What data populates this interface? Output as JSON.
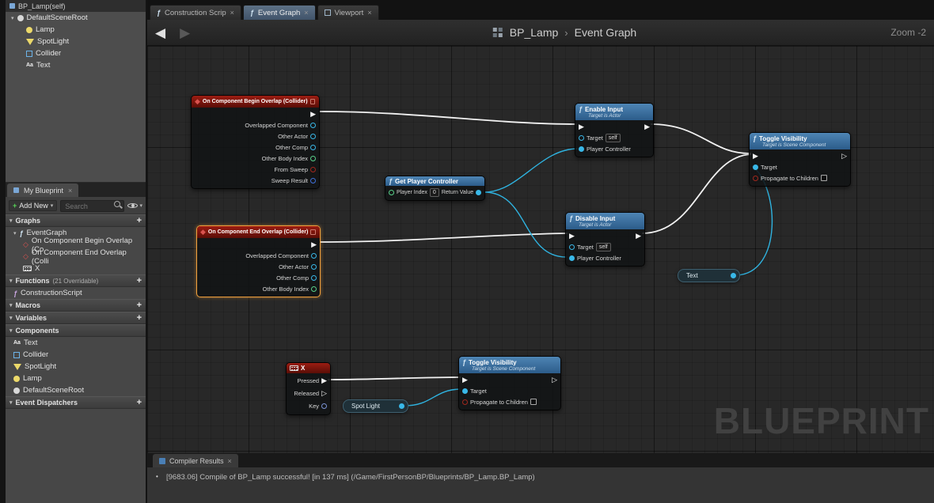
{
  "icons": {
    "caret_down": "▾",
    "plus": "+",
    "close": "×",
    "back_arrow": "◀",
    "forward_arrow": "▶",
    "exec_filled": "▶",
    "exec_hollow": "▷",
    "event_diamond": "◆",
    "event_diamond_hollow": "◇",
    "fn_glyph": "ƒ",
    "bullet": "•",
    "text_glyph": "Aa"
  },
  "components_panel": {
    "header": "BP_Lamp(self)",
    "root": "DefaultSceneRoot",
    "children": [
      "Lamp",
      "SpotLight",
      "Collider",
      "Text"
    ]
  },
  "my_blueprint": {
    "tab": "My Blueprint",
    "add_new": "Add New",
    "search_placeholder": "Search",
    "sections": {
      "graphs": "Graphs",
      "functions": "Functions",
      "functions_badge": "(21 Overridable)",
      "macros": "Macros",
      "variables": "Variables",
      "components": "Components",
      "dispatchers": "Event Dispatchers"
    },
    "graph_items": [
      "EventGraph",
      "On Component Begin Overlap (Co",
      "On Component End Overlap (Colli",
      "X"
    ],
    "function_items": [
      "ConstructionScript"
    ],
    "component_items": [
      "Text",
      "Collider",
      "SpotLight",
      "Lamp",
      "DefaultSceneRoot"
    ]
  },
  "doc_tabs": [
    "Construction Scrip",
    "Event Graph",
    "Viewport"
  ],
  "graph_toolbar": {
    "breadcrumb_root": "BP_Lamp",
    "breadcrumb_sep": "›",
    "breadcrumb_page": "Event Graph",
    "zoom": "Zoom -2"
  },
  "graph": {
    "watermark": "BLUEPRINT",
    "nodes": {
      "begin_overlap": {
        "title": "On Component Begin Overlap (Collider)",
        "pins": [
          "Overlapped Component",
          "Other Actor",
          "Other Comp",
          "Other Body Index",
          "From Sweep",
          "Sweep Result"
        ]
      },
      "end_overlap": {
        "title": "On Component End Overlap (Collider)",
        "pins": [
          "Overlapped Component",
          "Other Actor",
          "Other Comp",
          "Other Body Index"
        ]
      },
      "get_player_controller": {
        "title": "Get Player Controller",
        "input_label": "Player Index",
        "input_value": "0",
        "output_label": "Return Value"
      },
      "enable_input": {
        "title": "Enable Input",
        "subtitle": "Target is Actor",
        "target_label": "Target",
        "target_value": "self",
        "controller_label": "Player Controller"
      },
      "disable_input": {
        "title": "Disable Input",
        "subtitle": "Target is Actor",
        "target_label": "Target",
        "target_value": "self",
        "controller_label": "Player Controller"
      },
      "toggle_visibility_top": {
        "title": "Toggle Visibility",
        "subtitle": "Target is Scene Component",
        "target_label": "Target",
        "propagate_label": "Propagate to Children"
      },
      "toggle_visibility_bottom": {
        "title": "Toggle Visibility",
        "subtitle": "Target is Scene Component",
        "target_label": "Target",
        "propagate_label": "Propagate to Children"
      },
      "x_key_event": {
        "title": "X",
        "pressed_label": "Pressed",
        "released_label": "Released",
        "key_label": "Key"
      },
      "spotlight_var": {
        "label": "Spot Light"
      },
      "text_var": {
        "label": "Text"
      }
    }
  },
  "compiler": {
    "tab": "Compiler Results",
    "log": "[9683.06] Compile of BP_Lamp successful! [in 137 ms] (/Game/FirstPersonBP/Blueprints/BP_Lamp.BP_Lamp)"
  },
  "colors": {
    "event_node_header": "#7e150e",
    "function_node_header": "#3f75a3",
    "selection_orange": "#f2a13c",
    "exec_wire": "#f2f2f2",
    "data_wire": "#2fb3e0",
    "pin_cyan": "#39b8e8",
    "pin_green": "#59d18a",
    "pin_bool_red": "#a1281e",
    "pin_struct_blue": "#3f6fd9"
  }
}
